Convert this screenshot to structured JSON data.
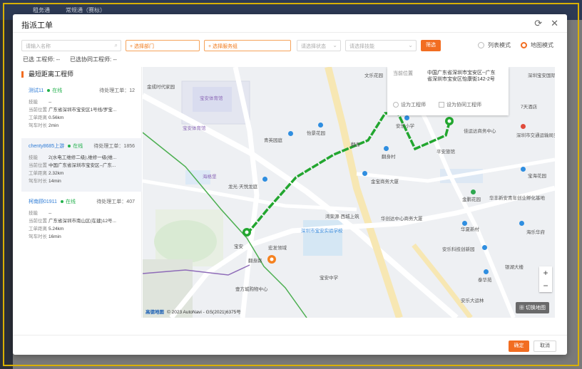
{
  "background": {
    "tabs": [
      "租务通",
      "常规通（赛标）"
    ]
  },
  "modal": {
    "title": "指派工单",
    "header_icons": [
      "refresh-icon",
      "close-icon"
    ]
  },
  "filters": {
    "name_placeholder": "请输入名称",
    "department": "+ 选择部门",
    "service_group": "+ 选择服务组",
    "status_placeholder": "请选择状态",
    "skill_placeholder": "请选择技能",
    "filter_button": "筛选",
    "mode_list": "列表模式",
    "mode_map": "地图模式",
    "selected_mode": "地图模式"
  },
  "selected": {
    "engineer_label": "已选 工程师:",
    "engineer_value": "--",
    "co_engineer_label": "已选协同工程师:",
    "co_engineer_value": "--"
  },
  "panel": {
    "title": "最短距离工程师",
    "field_labels": {
      "skill": "技能",
      "location": "当前位置",
      "distance": "工单距离",
      "duration": "驾车时长"
    },
    "engineers": [
      {
        "name": "测试11",
        "status": "在线",
        "pending": "待处理工单：12",
        "skill": "--",
        "location": "广东省深圳市宝安区1号线/罗宝...",
        "distance": "0.56km",
        "duration": "2min"
      },
      {
        "name": "chenty8685上游",
        "status": "在线",
        "pending": "待处理工单：1856",
        "skill": "2(水电工维修二级),维修一级(维...",
        "location": "中国广东省深圳市宝安区--广东...",
        "distance": "2.32km",
        "duration": "14min"
      },
      {
        "name": "柯南顾01911",
        "status": "在线",
        "pending": "待处理工单：407",
        "skill": "--",
        "location": "广东省深圳市南山区(在建)12号...",
        "distance": "5.24km",
        "duration": "16min"
      }
    ]
  },
  "map": {
    "info": {
      "location_label": "当前位置",
      "location_value": "中国广东省深圳市宝安区--广东省深圳市宝安区怡康街142-2号",
      "set_engineer": "设为工程师",
      "set_co_engineer": "设为协同工程师"
    },
    "labels": {
      "l1": "宝安体育馆",
      "l2": "海格堡",
      "l3": "宝安体育馆",
      "l4": "龙光·天悦龙庭",
      "l5": "青英园庭",
      "l6": "怡景花园",
      "l7": "翻身",
      "l8": "翻身村",
      "l9": "金宝商务大厦",
      "l10": "宝安中学",
      "l11": "深圳市宝安实验学校",
      "l12": "湾荣源·西城上筑",
      "l13": "华创达中心商务大厦",
      "l14": "安乐小学",
      "l15": "佳运达商务中心",
      "l16": "平安旅馆",
      "l17": "宝海花园",
      "l18": "金鹏花园",
      "l19": "华丰新安青年创业孵化基地",
      "l20": "华夏新村",
      "l21": "海乐华府",
      "l22": "安乐科技创新园",
      "l23": "银湖大楼",
      "l24": "泰华苑",
      "l25": "安乐大运林",
      "l26": "壹方城购物中心",
      "l27": "宏发领域",
      "l28": "翻身路",
      "l29": "宝安",
      "l30": "深圳宝安国际酒店",
      "l31": "7天酒店",
      "l32": "深圳市交通运输局宝安管理局",
      "l33": "文乐花园",
      "l34": "金成时代家园"
    },
    "switch_map": "切换地图",
    "logo": "高德地图",
    "copyright": "© 2023 AutoNavi - GS(2021)6375号"
  },
  "footer": {
    "ok": "确定",
    "cancel": "取消"
  }
}
